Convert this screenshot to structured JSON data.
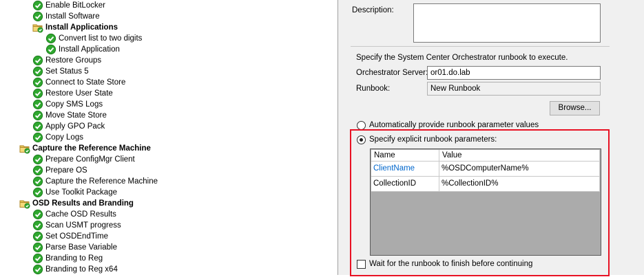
{
  "tree": {
    "items": [
      {
        "label": "Enable BitLocker",
        "type": "step",
        "level": 2
      },
      {
        "label": "Install Software",
        "type": "step",
        "level": 2
      },
      {
        "label": "Install Applications",
        "type": "group",
        "level": 2
      },
      {
        "label": "Convert list to two digits",
        "type": "step",
        "level": 3
      },
      {
        "label": "Install Application",
        "type": "step",
        "level": 3
      },
      {
        "label": "Restore Groups",
        "type": "step",
        "level": 2
      },
      {
        "label": "Set Status 5",
        "type": "step",
        "level": 2
      },
      {
        "label": "Connect to State Store",
        "type": "step",
        "level": 2
      },
      {
        "label": "Restore User State",
        "type": "step",
        "level": 2
      },
      {
        "label": "Copy SMS Logs",
        "type": "step",
        "level": 2
      },
      {
        "label": "Move State Store",
        "type": "step",
        "level": 2
      },
      {
        "label": "Apply GPO Pack",
        "type": "step",
        "level": 2
      },
      {
        "label": "Copy Logs",
        "type": "step",
        "level": 2
      },
      {
        "label": "Capture the Reference Machine",
        "type": "group",
        "level": 1
      },
      {
        "label": "Prepare ConfigMgr Client",
        "type": "step",
        "level": 2
      },
      {
        "label": "Prepare OS",
        "type": "step",
        "level": 2
      },
      {
        "label": "Capture the Reference Machine",
        "type": "step",
        "level": 2
      },
      {
        "label": "Use Toolkit Package",
        "type": "step",
        "level": 2
      },
      {
        "label": "OSD Results and Branding",
        "type": "group",
        "level": 1
      },
      {
        "label": "Cache OSD Results",
        "type": "step",
        "level": 2
      },
      {
        "label": "Scan USMT progress",
        "type": "step",
        "level": 2
      },
      {
        "label": "Set OSDEndTime",
        "type": "step",
        "level": 2
      },
      {
        "label": "Parse Base Variable",
        "type": "step",
        "level": 2
      },
      {
        "label": "Branding to Reg",
        "type": "step",
        "level": 2
      },
      {
        "label": "Branding to Reg x64",
        "type": "step",
        "level": 2
      }
    ]
  },
  "panel": {
    "description_label": "Description:",
    "description_value": "",
    "intro_text": "Specify the System Center Orchestrator runbook to execute.",
    "server_label": "Orchestrator Server:",
    "server_value": "or01.do.lab",
    "runbook_label": "Runbook:",
    "runbook_value": "New Runbook",
    "browse_label": "Browse...",
    "radio_auto_label": "Automatically provide runbook parameter values",
    "radio_auto_selected": false,
    "radio_explicit_label": "Specify explicit runbook parameters:",
    "radio_explicit_selected": true,
    "grid": {
      "columns": [
        "Name",
        "Value"
      ],
      "rows": [
        {
          "name": "ClientName",
          "value": "%OSDComputerName%",
          "selected": true
        },
        {
          "name": "CollectionID",
          "value": "%CollectionID%",
          "selected": false
        }
      ]
    },
    "wait_label": "Wait for the runbook to finish before continuing",
    "wait_checked": false
  },
  "colors": {
    "highlight_border": "#e81123",
    "selected_cell_text": "#0066cc",
    "grid_empty_area": "#ababab",
    "check_green": "#2fa82f"
  }
}
